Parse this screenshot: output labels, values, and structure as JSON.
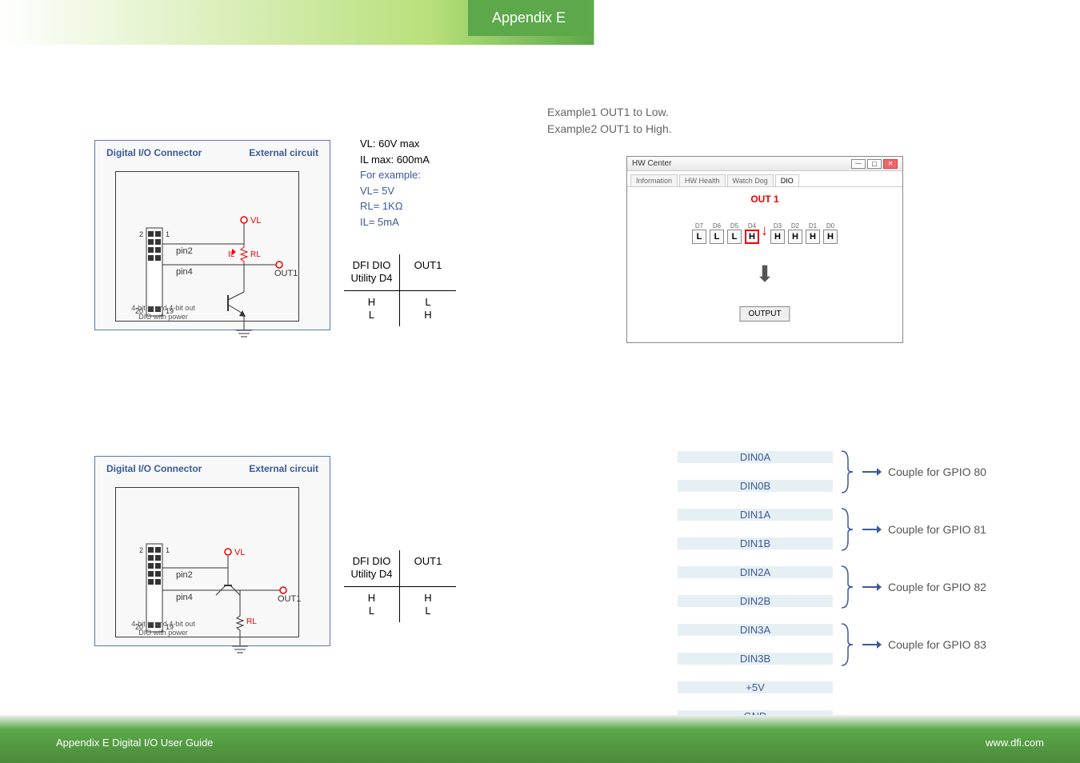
{
  "header": {
    "tab": "Appendix E"
  },
  "footer": {
    "left": "Appendix E Digital I/O User Guide",
    "right": "www.dfi.com"
  },
  "circuit": {
    "title_left": "Digital I/O Connector",
    "title_right": "External circuit",
    "pin2": "pin2",
    "pin4": "pin4",
    "num2": "2",
    "num1": "1",
    "num20": "20",
    "num19": "19",
    "vl": "VL",
    "rl": "RL",
    "il": "IL",
    "out1": "OUT1",
    "note": "4-bit in and 4-bit out\nDIO with power"
  },
  "spec1": {
    "vl": "VL: 60V max",
    "il": "IL max: 600mA",
    "ex": "For example:",
    "vl_ex": "VL= 5V",
    "rl_ex": "RL= 1KΩ",
    "il_ex": "IL= 5mA"
  },
  "spectable1": {
    "h1": "DFI DIO\nUtility D4",
    "h2": "OUT1",
    "r1a": "H",
    "r1b": "L",
    "r2a": "L",
    "r2b": "H"
  },
  "spectable2": {
    "h1": "DFI DIO\nUtility D4",
    "h2": "OUT1",
    "r1a": "H",
    "r1b": "H",
    "r2a": "L",
    "r2b": "L"
  },
  "examples": {
    "l1": "Example1 OUT1 to Low.",
    "l2": "Example2 OUT1 to High."
  },
  "hw": {
    "title": "HW Center",
    "tabs": [
      "Information",
      "HW Health",
      "Watch Dog",
      "DIO"
    ],
    "out1": "OUT 1",
    "labels": [
      "D7",
      "D6",
      "D5",
      "D4",
      "D3",
      "D2",
      "D1",
      "D0"
    ],
    "values": [
      "L",
      "L",
      "L",
      "H",
      "H",
      "H",
      "H",
      "H"
    ],
    "highlight": 3,
    "output": "OUTPUT"
  },
  "gpio": {
    "rows": [
      "DIN0A",
      "DIN0B",
      "DIN1A",
      "DIN1B",
      "DIN2A",
      "DIN2B",
      "DIN3A",
      "DIN3B",
      "+5V",
      "GND"
    ],
    "couples": [
      "Couple for GPIO 80",
      "Couple for GPIO 81",
      "Couple for GPIO 82",
      "Couple for GPIO 83"
    ]
  }
}
